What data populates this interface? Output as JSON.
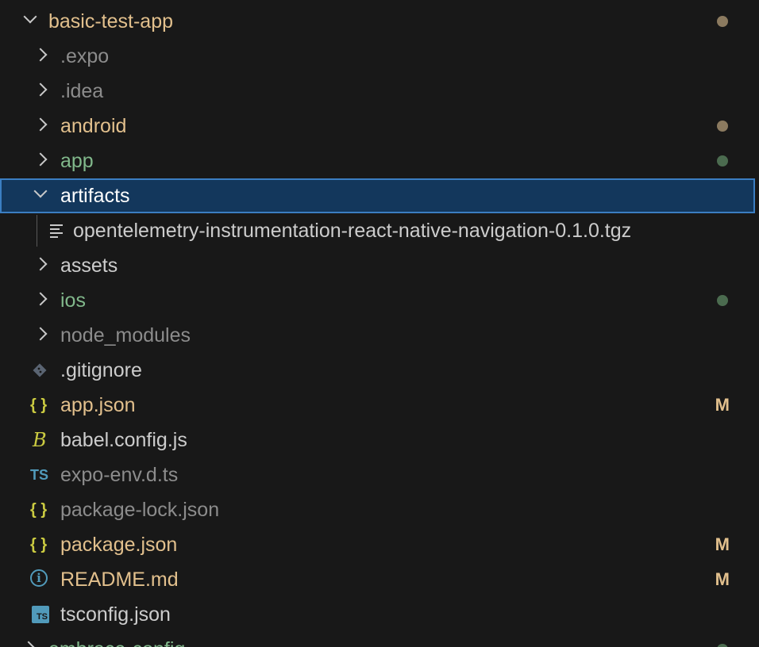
{
  "colors": {
    "background": "#181818",
    "selected_bg": "#13375c",
    "selected_border": "#3b7ec2",
    "modified": "#e2c08d",
    "untracked": "#81b88b",
    "ignored": "#8c8c8c",
    "normal": "#cccccc",
    "json_icon": "#cbcb41",
    "ts_icon": "#519aba",
    "dot_modified": "#8b7a5f",
    "dot_untracked": "#4b6b4f"
  },
  "tree": {
    "root": {
      "label": "basic-test-app",
      "expanded": true,
      "status": "modified-dot"
    },
    "items": [
      {
        "label": ".expo",
        "type": "folder",
        "expanded": false,
        "status": "ignored"
      },
      {
        "label": ".idea",
        "type": "folder",
        "expanded": false,
        "status": "ignored"
      },
      {
        "label": "android",
        "type": "folder",
        "expanded": false,
        "status": "modified-dot"
      },
      {
        "label": "app",
        "type": "folder",
        "expanded": false,
        "status": "untracked-dot"
      },
      {
        "label": "artifacts",
        "type": "folder",
        "expanded": true,
        "selected": true
      },
      {
        "label": "opentelemetry-instrumentation-react-native-navigation-0.1.0.tgz",
        "type": "file",
        "icon": "lines-icon"
      },
      {
        "label": "assets",
        "type": "folder",
        "expanded": false
      },
      {
        "label": "ios",
        "type": "folder",
        "expanded": false,
        "status": "untracked-dot"
      },
      {
        "label": "node_modules",
        "type": "folder",
        "expanded": false,
        "status": "ignored"
      },
      {
        "label": ".gitignore",
        "type": "file",
        "icon": "git-icon"
      },
      {
        "label": "app.json",
        "type": "file",
        "icon": "json-braces-icon",
        "badge": "M"
      },
      {
        "label": "babel.config.js",
        "type": "file",
        "icon": "babel-icon"
      },
      {
        "label": "expo-env.d.ts",
        "type": "file",
        "icon": "ts-icon",
        "status": "ignored"
      },
      {
        "label": "package-lock.json",
        "type": "file",
        "icon": "json-braces-icon",
        "status": "ignored"
      },
      {
        "label": "package.json",
        "type": "file",
        "icon": "json-braces-icon",
        "badge": "M"
      },
      {
        "label": "README.md",
        "type": "file",
        "icon": "info-icon",
        "badge": "M"
      },
      {
        "label": "tsconfig.json",
        "type": "file",
        "icon": "tsconfig-icon"
      }
    ],
    "next_root": {
      "label": "embrace-config",
      "expanded": false,
      "status": "untracked-dot"
    }
  },
  "icons": {
    "json_glyph": "{ }",
    "ts_glyph": "TS",
    "babel_glyph": "B",
    "info_glyph": "i"
  }
}
